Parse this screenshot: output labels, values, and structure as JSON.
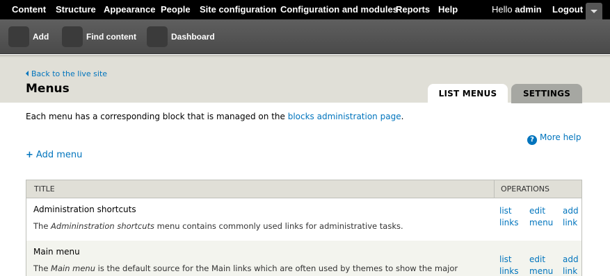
{
  "toolbar": {
    "nav": [
      "Content",
      "Structure",
      "Appearance",
      "People",
      "Site configuration",
      "Configuration and modules",
      "Reports",
      "Help"
    ],
    "hello_prefix": "Hello",
    "user": "admin",
    "logout": "Logout"
  },
  "shortcuts": [
    "Add",
    "Find content",
    "Dashboard"
  ],
  "header": {
    "back_link": "Back to the live site",
    "title": "Menus",
    "tabs": [
      "LIST MENUS",
      "SETTINGS"
    ]
  },
  "intro": {
    "before": "Each menu has a corresponding block that is managed on the",
    "link": "blocks administration page",
    "after": "."
  },
  "more_help": "More help",
  "add_menu": "Add menu",
  "table": {
    "columns": [
      "TITLE",
      "OPERATIONS"
    ],
    "rows": [
      {
        "name": "Administration shortcuts",
        "desc_before": "The",
        "desc_em": "Admininstration shortcuts",
        "desc_after": "menu contains commonly used links for administrative tasks.",
        "ops": [
          [
            "list",
            "links"
          ],
          [
            "edit",
            "menu"
          ],
          [
            "add",
            "link"
          ]
        ]
      },
      {
        "name": "Main menu",
        "desc_before": "The",
        "desc_em": "Main menu",
        "desc_after": "is the default source for the Main links which are often used by themes to show the major",
        "ops": [
          [
            "list",
            "links"
          ],
          [
            "edit",
            "menu"
          ],
          [
            "add",
            "link"
          ]
        ]
      }
    ]
  },
  "colors": {
    "link": "#0074bd",
    "toolbar": "#000000",
    "header_band": "#e0dfd7",
    "settings_tab": "#a6a7a2"
  }
}
